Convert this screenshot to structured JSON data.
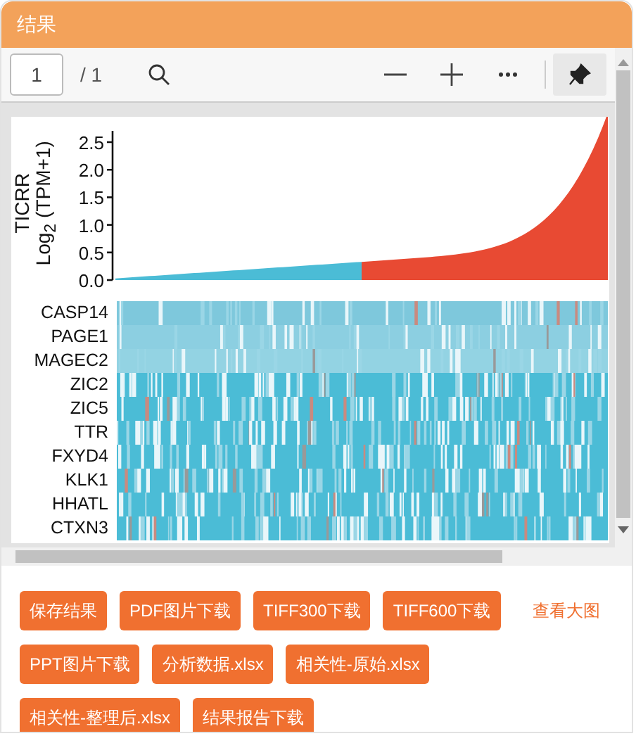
{
  "panel": {
    "title": "结果"
  },
  "toolbar": {
    "page": "1",
    "page_count": "/ 1"
  },
  "chart": {
    "title": "TICRR",
    "ylabel": "Log$_{2}$ (TPM+1)",
    "yticks": [
      "2.5",
      "2.0",
      "1.5",
      "1.0",
      "0.5",
      "0.0"
    ]
  },
  "heatmap": {
    "genes": [
      "CASP14",
      "PAGE1",
      "MAGEC2",
      "ZIC2",
      "ZIC5",
      "TTR",
      "FXYD4",
      "KLK1",
      "HHATL",
      "CTXN3"
    ]
  },
  "actions": [
    [
      {
        "kind": "button",
        "label": "保存结果"
      },
      {
        "kind": "button",
        "label": "PDF图片下载"
      },
      {
        "kind": "button",
        "label": "TIFF300下载"
      },
      {
        "kind": "button",
        "label": "TIFF600下载"
      },
      {
        "kind": "link",
        "label": "查看大图"
      }
    ],
    [
      {
        "kind": "button",
        "label": "PPT图片下载"
      },
      {
        "kind": "button",
        "label": "分析数据.xlsx"
      },
      {
        "kind": "button",
        "label": "相关性-原始.xlsx"
      }
    ],
    [
      {
        "kind": "button",
        "label": "相关性-整理后.xlsx"
      },
      {
        "kind": "button",
        "label": "结果报告下载"
      }
    ]
  ]
}
